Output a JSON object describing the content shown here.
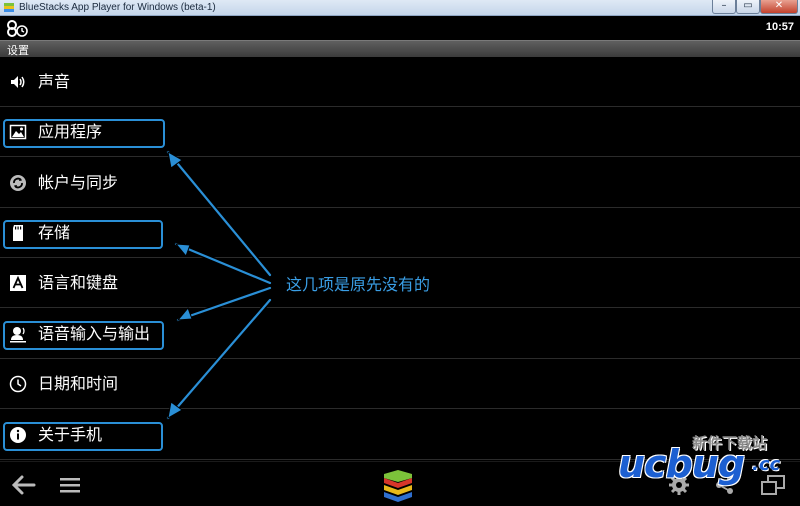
{
  "window": {
    "title": "BlueStacks App Player for Windows (beta-1)",
    "minimize": "–",
    "maximize": "▭",
    "close": "✕"
  },
  "statusbar": {
    "time": "10:57"
  },
  "settings": {
    "title": "设置",
    "items": [
      {
        "label": "声音",
        "icon": "volume-icon"
      },
      {
        "label": "应用程序",
        "icon": "apps-image-icon",
        "highlighted": true
      },
      {
        "label": "帐户与同步",
        "icon": "sync-icon"
      },
      {
        "label": "存储",
        "icon": "sd-card-icon",
        "highlighted": true
      },
      {
        "label": "语言和键盘",
        "icon": "keyboard-a-icon"
      },
      {
        "label": "语音输入与输出",
        "icon": "voice-io-icon",
        "highlighted": true
      },
      {
        "label": "日期和时间",
        "icon": "clock-icon"
      },
      {
        "label": "关于手机",
        "icon": "info-icon",
        "highlighted": true
      }
    ]
  },
  "annotation": {
    "text": "这几项是原先没有的",
    "color": "#2a8fd6"
  },
  "watermark": {
    "brand": "ucbug",
    "tld": ".cc",
    "subtitle": "新件下载站"
  },
  "colors": {
    "highlight": "#2a8fd6",
    "background": "#000000"
  }
}
